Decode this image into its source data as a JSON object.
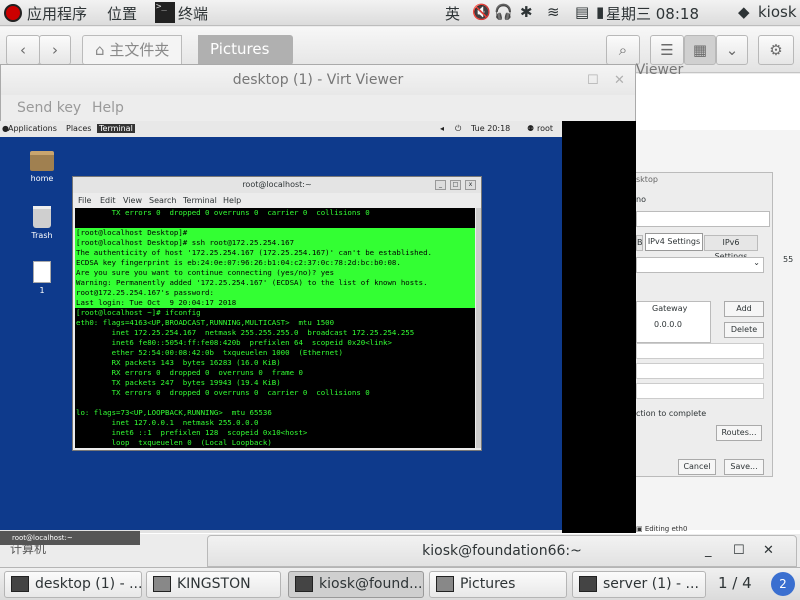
{
  "host_topbar": {
    "applications": "应用程序",
    "places": "位置",
    "active_app": "终端",
    "input_method": "英",
    "datetime": "星期三 08:18",
    "user": "kiosk"
  },
  "file_manager": {
    "home_label": "主文件夹",
    "current_folder": "Pictures"
  },
  "virt_viewer": {
    "title": "desktop (1) - Virt Viewer",
    "back_title": "rt Viewer",
    "menu": [
      "Send key",
      "Help"
    ]
  },
  "guest": {
    "topbar": {
      "applications": "Applications",
      "places": "Places",
      "terminal": "Terminal",
      "time": "Tue 20:18",
      "user": "root"
    },
    "desktop_icons": [
      "home",
      "Trash",
      "1"
    ],
    "terminal": {
      "title": "root@localhost:~",
      "menu": [
        "File",
        "Edit",
        "View",
        "Search",
        "Terminal",
        "Help"
      ],
      "lines": [
        {
          "text": "        TX errors 0  dropped 0 overruns 0  carrier 0  collisions 0",
          "hl": false
        },
        {
          "text": "",
          "hl": false
        },
        {
          "text": "[root@localhost Desktop]# ",
          "hl": true
        },
        {
          "text": "[root@localhost Desktop]# ssh root@172.25.254.167",
          "hl": true
        },
        {
          "text": "The authenticity of host '172.25.254.167 (172.25.254.167)' can't be established.",
          "hl": true
        },
        {
          "text": "ECDSA key fingerprint is eb:24:0e:07:96:26:b1:04:c2:37:0c:78:2d:bc:b0:08.",
          "hl": true
        },
        {
          "text": "Are you sure you want to continue connecting (yes/no)? yes",
          "hl": true
        },
        {
          "text": "Warning: Permanently added '172.25.254.167' (ECDSA) to the list of known hosts.",
          "hl": true
        },
        {
          "text": "root@172.25.254.167's password:",
          "hl": true
        },
        {
          "text": "Last login: Tue Oct  9 20:04:17 2018",
          "hl": true
        },
        {
          "text": "[root@localhost ~]# ifconfig",
          "hl": false
        },
        {
          "text": "eth0: flags=4163<UP,BROADCAST,RUNNING,MULTICAST>  mtu 1500",
          "hl": false
        },
        {
          "text": "        inet 172.25.254.167  netmask 255.255.255.0  broadcast 172.25.254.255",
          "hl": false
        },
        {
          "text": "        inet6 fe80::5054:ff:fe08:420b  prefixlen 64  scopeid 0x20<link>",
          "hl": false
        },
        {
          "text": "        ether 52:54:00:08:42:0b  txqueuelen 1000  (Ethernet)",
          "hl": false
        },
        {
          "text": "        RX packets 143  bytes 16283 (16.0 KiB)",
          "hl": false
        },
        {
          "text": "        RX errors 0  dropped 0  overruns 0  frame 0",
          "hl": false
        },
        {
          "text": "        TX packets 247  bytes 19943 (19.4 KiB)",
          "hl": false
        },
        {
          "text": "        TX errors 0  dropped 0 overruns 0  carrier 0  collisions 0",
          "hl": false
        },
        {
          "text": "",
          "hl": false
        },
        {
          "text": "lo: flags=73<UP,LOOPBACK,RUNNING>  mtu 65536",
          "hl": false
        },
        {
          "text": "        inet 127.0.0.1  netmask 255.0.0.0",
          "hl": false
        },
        {
          "text": "        inet6 ::1  prefixlen 128  scopeid 0x10<host>",
          "hl": false
        },
        {
          "text": "        loop  txqueuelen 0  (Local Loopback)",
          "hl": false
        }
      ]
    },
    "bottom_task": "root@localhost:~"
  },
  "net_dialog": {
    "title": "sktop",
    "name_label": "no",
    "tabs": [
      "B",
      "IPv4 Settings",
      "IPv6 Settings"
    ],
    "gateway_header": "Gateway",
    "gateway_value": "0.0.0.0",
    "add_label": "Add",
    "delete_label": "Delete",
    "complete_text": "ction to complete",
    "routes_label": "Routes...",
    "cancel_label": "Cancel",
    "save_label": "Save...",
    "editing_label": "Editing eth0",
    "side_value": "55"
  },
  "host_desktop_label": "计算机",
  "notification": {
    "title": "kiosk@foundation66:~"
  },
  "taskbar": {
    "items": [
      "desktop (1) - ...",
      "KINGSTON",
      "kiosk@found...",
      "Pictures",
      "server (1) - ..."
    ],
    "workspace": "1 / 4"
  }
}
